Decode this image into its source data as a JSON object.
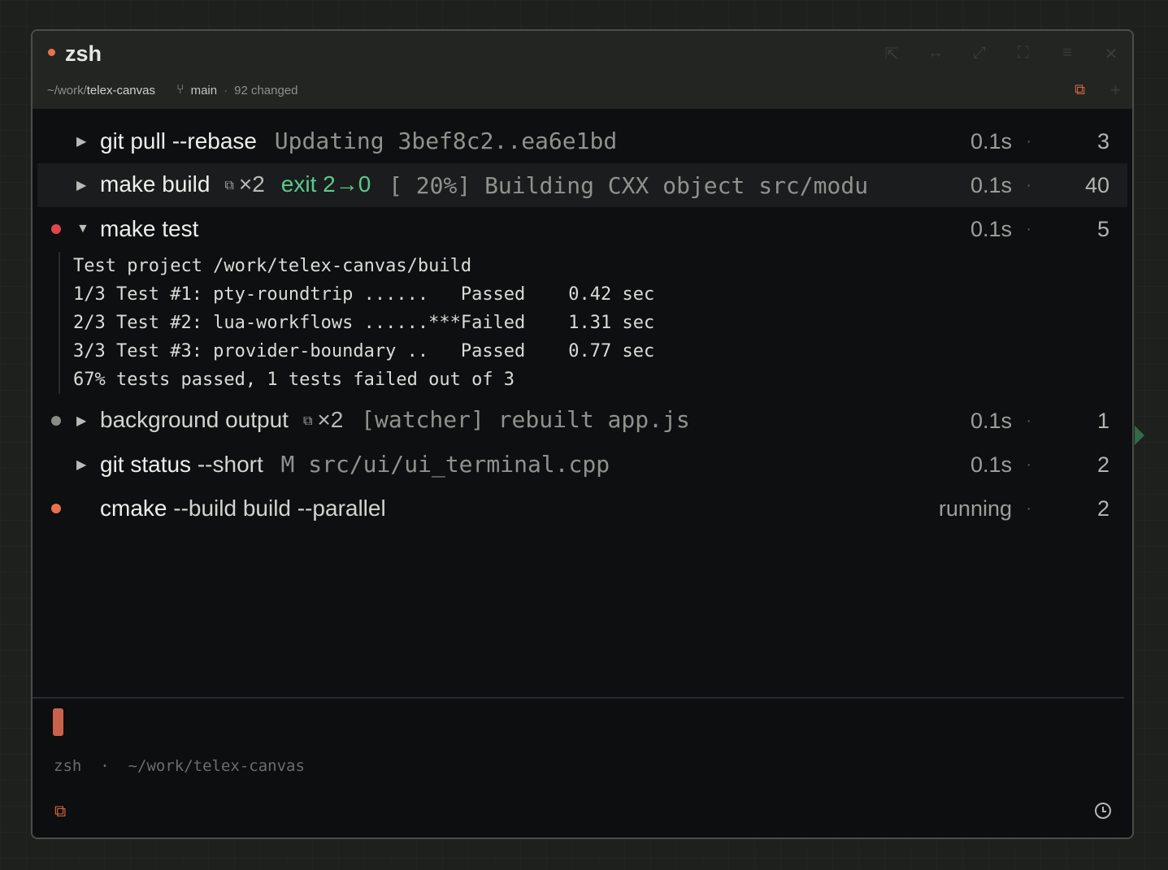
{
  "window": {
    "title": "zsh",
    "path_prefix": "~/work/",
    "path_name": "telex-canvas",
    "branch": "main",
    "sep": "·",
    "changed": "92 changed",
    "controls": [
      "⇱",
      "↔",
      "⤢",
      "⛶",
      "≡",
      "✕"
    ],
    "link_icon": "link-icon"
  },
  "rows": [
    {
      "arrow": "▶",
      "cmd": "git pull --rebase",
      "preview": "Updating 3bef8c2..ea6e1bd",
      "time": "0.1s",
      "count": "3"
    },
    {
      "arrow": "▶",
      "cmd": "make build",
      "mult": "×2",
      "exit": "exit 2→0",
      "preview": "[ 20%] Building CXX object src/modu",
      "time": "0.1s",
      "count": "40"
    },
    {
      "arrow": "▼",
      "cmd": "make test",
      "time": "0.1s",
      "count": "5",
      "dot_color": "#e0474c"
    },
    {
      "arrow": "▶",
      "cmd": "background output",
      "mult": "×2",
      "preview": "[watcher] rebuilt app.js",
      "time": "0.1s",
      "count": "1",
      "dot_color": "#8a8c88"
    },
    {
      "arrow": "▶",
      "cmd": "git status",
      "args": "--short",
      "preview": "M src/ui/ui_terminal.cpp",
      "time": "0.1s",
      "count": "2"
    },
    {
      "cmd": "cmake",
      "args": "--build build --parallel",
      "time": "running",
      "count": "2",
      "dot_color": "#e8724c"
    }
  ],
  "output_lines": [
    "Test project /work/telex-canvas/build",
    "1/3 Test #1: pty-roundtrip ......   Passed    0.42 sec",
    "2/3 Test #2: lua-workflows ......***Failed    1.31 sec",
    "3/3 Test #3: provider-boundary ..   Passed    0.77 sec",
    "67% tests passed, 1 tests failed out of 3"
  ],
  "prompt": {
    "shell": "zsh",
    "sep": "·",
    "cwd": "~/work/telex-canvas"
  },
  "colors": {
    "accent": "#e8724c",
    "failed_dot": "#e0474c",
    "exit_green": "#5cc98a",
    "cursor": "#c8624a"
  }
}
